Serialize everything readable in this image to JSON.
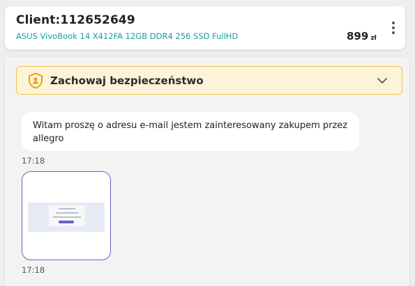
{
  "header": {
    "client_title": "Client:112652649",
    "product_name": "ASUS VivoBook 14 X412FA 12GB DDR4 256 SSD FullHD",
    "price_value": "899",
    "price_currency": "zł",
    "more_icon": "more-vertical-icon"
  },
  "safety_banner": {
    "title": "Zachowaj bezpieczeństwo",
    "icon": "shield-icon",
    "toggle_icon": "chevron-down-icon"
  },
  "messages": [
    {
      "type": "text",
      "text": "Witam proszę o adresu e-mail jestem zainteresowany zakupem przez allegro",
      "time": "17:18"
    },
    {
      "type": "image",
      "time": "17:18"
    }
  ],
  "colors": {
    "accent_link": "#1a9c9c",
    "banner_bg": "#fdf3d8",
    "banner_border": "#f2c14e",
    "attachment_border": "#6f5fbf"
  }
}
